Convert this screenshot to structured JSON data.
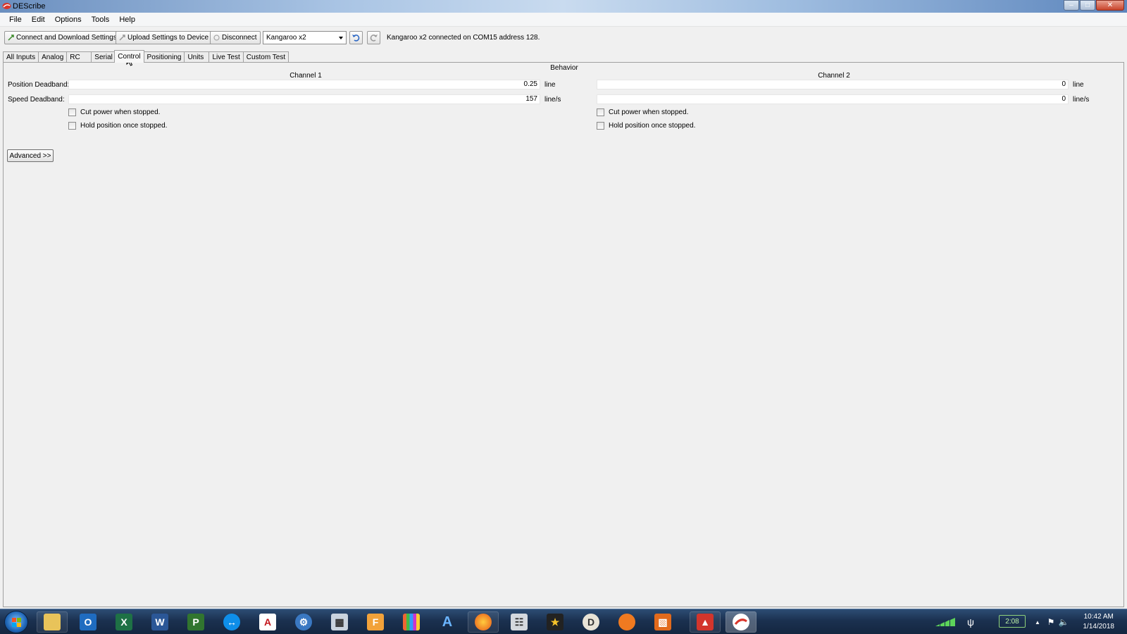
{
  "window": {
    "title": "DEScribe"
  },
  "menu": [
    "File",
    "Edit",
    "Options",
    "Tools",
    "Help"
  ],
  "toolbar": {
    "connect_label": "Connect and Download Settings",
    "upload_label": "Upload Settings to Device",
    "disconnect_label": "Disconnect",
    "device_select": "Kangaroo x2",
    "status": "Kangaroo x2 connected on COM15 address 128."
  },
  "tabs": [
    "All Inputs",
    "Analog",
    "RC",
    "Serial",
    "Control",
    "Positioning",
    "Units",
    "Live Test",
    "Custom Test"
  ],
  "active_tab": "Control",
  "behavior": {
    "section_title": "Behavior",
    "channel1_title": "Channel 1",
    "channel2_title": "Channel 2",
    "position_deadband_label": "Position Deadband:",
    "speed_deadband_label": "Speed Deadband:",
    "channel1": {
      "position_deadband": "0.25",
      "position_unit": "line",
      "speed_deadband": "157",
      "speed_unit": "line/s",
      "cut_power_label": "Cut power when stopped.",
      "hold_position_label": "Hold position once stopped."
    },
    "channel2": {
      "position_deadband": "0",
      "position_unit": "line",
      "speed_deadband": "0",
      "speed_unit": "line/s",
      "cut_power_label": "Cut power when stopped.",
      "hold_position_label": "Hold position once stopped."
    },
    "advanced_label": "Advanced >>"
  },
  "taskbar": {
    "apps": [
      "windows-explorer",
      "outlook",
      "excel",
      "word",
      "project",
      "teamviewer",
      "acrobat",
      "settings",
      "calculator",
      "filezilla",
      "app-bars",
      "app-a",
      "firefox",
      "keyboard",
      "app-dark",
      "app-circle",
      "app-orange",
      "app-frame",
      "app-red",
      "describe"
    ],
    "battery": "2:08",
    "time": "10:42 AM",
    "date": "1/14/2018"
  }
}
